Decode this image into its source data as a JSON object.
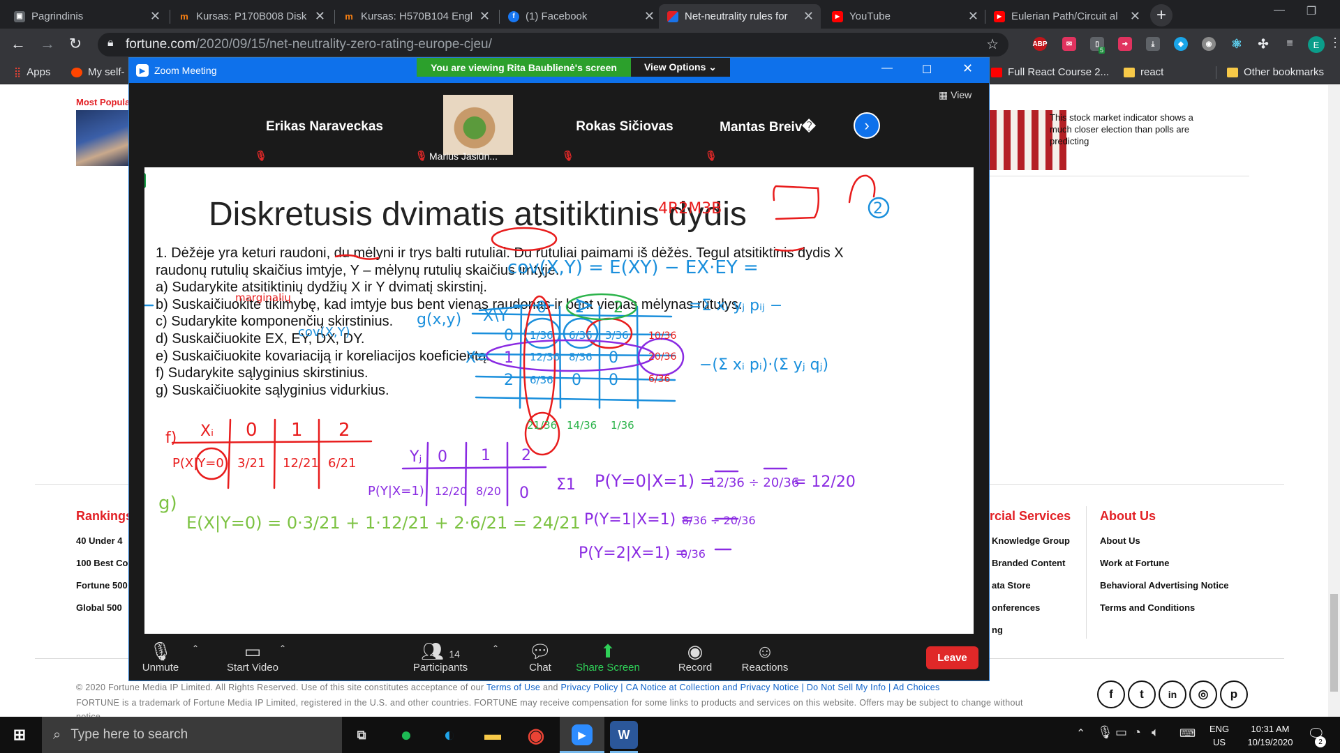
{
  "tabs": [
    {
      "title": "Pagrindinis",
      "icon": "document-icon",
      "color": "#3c4043"
    },
    {
      "title": "Kursas: P170B008 Disk",
      "icon": "moodle-icon",
      "color": "#f98012"
    },
    {
      "title": "Kursas: H570B104 Engl",
      "icon": "moodle-icon",
      "color": "#f98012"
    },
    {
      "title": "(1) Facebook",
      "icon": "facebook-icon",
      "color": "#1877f2"
    },
    {
      "title": "Net-neutrality rules for",
      "icon": "fortune-icon",
      "color": "#e21f24",
      "active": true
    },
    {
      "title": "YouTube",
      "icon": "youtube-icon",
      "color": "#ff0000"
    },
    {
      "title": "Eulerian Path/Circuit al",
      "icon": "youtube-icon",
      "color": "#ff0000"
    }
  ],
  "address": {
    "host": "fortune.com",
    "path": "/2020/09/15/net-neutrality-zero-rating-europe-cjeu/"
  },
  "bookmarks": {
    "left": [
      {
        "label": "Apps"
      },
      {
        "label": "My self-"
      }
    ],
    "right": [
      {
        "label": "Full React Course 2..."
      },
      {
        "label": "react"
      },
      {
        "label": "Other bookmarks"
      }
    ]
  },
  "extensions": {
    "abp": "ABP",
    "badge": "5",
    "profile": "E"
  },
  "fortune": {
    "most_popular": "Most Popular",
    "story": "This stock market indicator shows a much closer election than polls are predicting",
    "rankings_title": "Rankings",
    "rankings": [
      "40 Under 4",
      "100 Best Co",
      "Fortune 500",
      "Global 500"
    ],
    "services_title": "rcial Services",
    "services": [
      "Knowledge Group",
      "Branded Content",
      "ata Store",
      "onferences",
      "ng"
    ],
    "about_title": "About Us",
    "about": [
      "About Us",
      "Work at Fortune",
      "Behavioral Advertising Notice",
      "Terms and Conditions"
    ],
    "footer1a": "© 2020 Fortune Media IP Limited. All Rights Reserved. Use of this site constitutes acceptance of our ",
    "footer1_links": [
      "Terms of Use",
      "and",
      "Privacy Policy",
      "| CA Notice at Collection and Privacy Notice",
      "| Do Not Sell My Info",
      "| Ad Choices"
    ],
    "footer2": "FORTUNE is a trademark of Fortune Media IP Limited, registered in the U.S. and other countries. FORTUNE may receive compensation for some links to products and services on this website. Offers may be subject to change without",
    "footer3": "notice.",
    "social": [
      "f",
      "t",
      "in",
      "◎",
      "p"
    ]
  },
  "zoom": {
    "title": "Zoom Meeting",
    "banner": "You are viewing Rita Baublienė's screen",
    "view_options": "View Options ⌄",
    "view": "View",
    "participants": [
      {
        "name": "Erikas Naraveckas"
      },
      {
        "name": "Marius Jasiūn..."
      },
      {
        "name": "Rokas Sičiovas"
      },
      {
        "name": "Mantas Breiv�"
      }
    ],
    "controls": {
      "unmute": "Unmute",
      "start_video": "Start Video",
      "participants": "Participants",
      "participants_count": "14",
      "chat": "Chat",
      "share_screen": "Share Screen",
      "record": "Record",
      "reactions": "Reactions",
      "leave": "Leave"
    }
  },
  "slide": {
    "title": "Diskretusis dvimatis atsitiktinis dydis",
    "lines": [
      "1. Dėžėje yra keturi raudoni, du mėlyni ir trys balti rutuliai. Du rutuliai paimami iš dėžės. Tegul atsitiktinis dydis X",
      "raudonų  rutulių skaičius imtyje, Y – mėlynų rutulių skaičius imtyje.",
      "a) Sudarykite atsitiktinių dydžių X ir Y dvimatį skirstinį.",
      "b) Suskaičiuokite tikimybę, kad imtyje bus bent vienas raudonas ir bent vienas mėlynas rutulys.",
      "c) Sudarykite komponenčių skirstinius.",
      "d) Suskaičiuokite EX, EY, DX, DY.",
      "e) Suskaičiuokite kovariaciją ir koreliacijos koeficientą.",
      "f) Sudarykite sąlyginius skirstinius.",
      "g) Suskaičiuokite sąlyginius vidurkius."
    ],
    "ink": {
      "code": "4R2M3B",
      "circled": "2",
      "cov_formula": "cov(X,Y) = E(XY) − EX·EY =",
      "sum1": "=Σ xᵢ yⱼ pᵢⱼ −",
      "sum2": "−(Σ xᵢ pᵢ)·(Σ yⱼ qⱼ)",
      "marg": "marginalių",
      "covxy": "cov(X,Y)",
      "gxy": "g(x,y)",
      "xy": "X\\Y",
      "x_eq": "X=",
      "grid_cols": [
        "0",
        "1",
        "2"
      ],
      "grid_rows": [
        "0",
        "1",
        "2"
      ],
      "grid": [
        [
          "1/36",
          "6/36",
          "3/36"
        ],
        [
          "12/36",
          "8/36",
          "0"
        ],
        [
          "6/36",
          "0",
          "0"
        ]
      ],
      "row_sums": [
        "10/36",
        "20/36",
        "6/36"
      ],
      "col_sums": [
        "21/36",
        "14/36",
        "1/36"
      ],
      "f_label": "f)",
      "xi": "Xᵢ",
      "fx_vals": [
        "0",
        "1",
        "2"
      ],
      "fx_row": "P(X|Y=0)",
      "fx_probs": [
        "3/21",
        "12/21",
        "6/21"
      ],
      "yj": "Yⱼ",
      "fy_vals": [
        "0",
        "1",
        "2"
      ],
      "fy_row": "P(Y|X=1)",
      "fy_probs": [
        "12/20",
        "8/20",
        "0"
      ],
      "sigma": "Σ1",
      "g_label": "g)",
      "g_formula": "E(X|Y=0) = 0·3/21 + 1·12/21 + 2·6/21 = 24/21",
      "p0": "P(Y=0|X=1) =",
      "p0_frac": "12/36 ÷ 20/36",
      "p0_res": "= 12/20",
      "p1": "P(Y=1|X=1) =",
      "p1_frac": "8/36 ÷ 20/36",
      "p2": "P(Y=2|X=1) =",
      "p2_frac": "0/36"
    }
  },
  "taskbar": {
    "search": "Type here to search",
    "lang1": "ENG",
    "lang2": "US",
    "time": "10:31 AM",
    "date": "10/19/2020",
    "notif": "2"
  }
}
